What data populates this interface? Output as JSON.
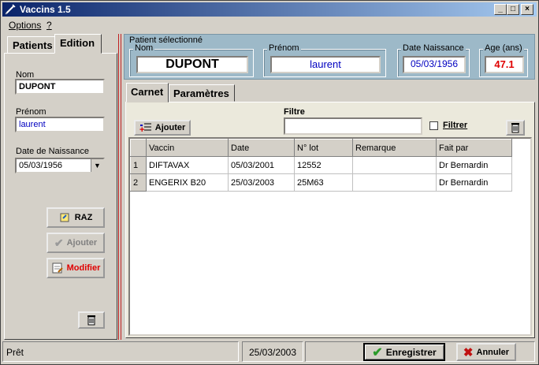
{
  "window": {
    "title": "Vaccins 1.5",
    "controls": [
      "_",
      "□",
      "×"
    ]
  },
  "menu": {
    "items": [
      "Options",
      "?"
    ]
  },
  "left_tabs": {
    "items": [
      "Patients",
      "Edition"
    ],
    "active": "Edition"
  },
  "edition": {
    "nom_label": "Nom",
    "nom_value": "DUPONT",
    "prenom_label": "Prénom",
    "prenom_value": "laurent",
    "ddn_label": "Date de Naissance",
    "ddn_value": "05/03/1956",
    "raz_label": "RAZ",
    "ajouter_label": "Ajouter",
    "modifier_label": "Modifier"
  },
  "patient_header": {
    "group_label": "Patient sélectionné",
    "nom_label": "Nom",
    "nom_value": "DUPONT",
    "prenom_label": "Prénom",
    "prenom_value": "laurent",
    "ddn_label": "Date Naissance",
    "ddn_value": "05/03/1956",
    "age_label": "Age (ans)",
    "age_value": "47.1"
  },
  "right_tabs": {
    "items": [
      "Carnet",
      "Paramètres"
    ],
    "active": "Carnet"
  },
  "carnet": {
    "ajouter_label": "Ajouter",
    "filtre_label": "Filtre",
    "filtre_value": "",
    "filtrer_label": "Filtrer",
    "filtrer_checked": false,
    "columns": [
      "Vaccin",
      "Date",
      "N° lot",
      "Remarque",
      "Fait par"
    ],
    "rows": [
      {
        "num": "1",
        "vaccin": "DIFTAVAX",
        "date": "05/03/2001",
        "lot": "12552",
        "remarque": "",
        "fait_par": "Dr Bernardin"
      },
      {
        "num": "2",
        "vaccin": "ENGERIX B20",
        "date": "25/03/2003",
        "lot": "25M63",
        "remarque": "",
        "fait_par": "Dr Bernardin"
      }
    ]
  },
  "status": {
    "text": "Prêt",
    "date": "25/03/2003",
    "enregistrer_label": "Enregistrer",
    "annuler_label": "Annuler"
  },
  "colors": {
    "title_start": "#0a246a",
    "header_panel": "#9db9c8",
    "age_value": "#e00000",
    "link_blue": "#0000c0"
  }
}
